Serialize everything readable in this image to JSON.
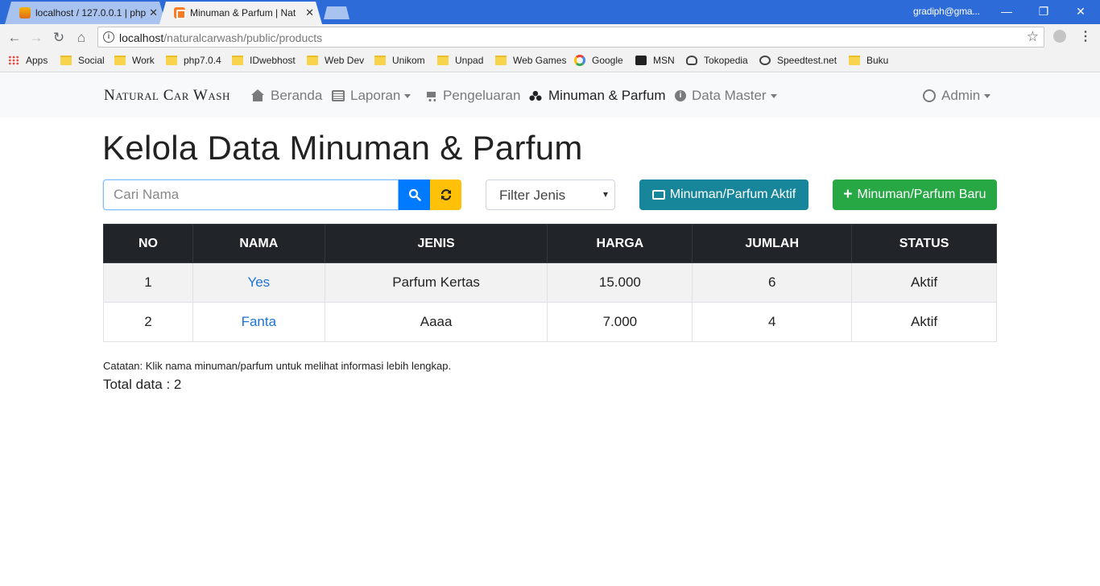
{
  "browser": {
    "tabs": [
      {
        "title": "localhost / 127.0.0.1 | php",
        "icon": "phpmyadmin-icon",
        "active": false
      },
      {
        "title": "Minuman & Parfum | Nat",
        "icon": "xampp-icon",
        "active": true
      }
    ],
    "profile": "gradiph@gma...",
    "url_host": "localhost",
    "url_path": "/naturalcarwash/public/products",
    "bookmarks": [
      {
        "label": "Apps",
        "icon": "apps-grid-icon"
      },
      {
        "label": "Social",
        "icon": "folder-icon"
      },
      {
        "label": "Work",
        "icon": "folder-icon"
      },
      {
        "label": "php7.0.4",
        "icon": "folder-icon"
      },
      {
        "label": "IDwebhost",
        "icon": "folder-icon"
      },
      {
        "label": "Web Dev",
        "icon": "folder-icon"
      },
      {
        "label": "Unikom",
        "icon": "folder-icon"
      },
      {
        "label": "Unpad",
        "icon": "folder-icon"
      },
      {
        "label": "Web Games",
        "icon": "folder-icon"
      },
      {
        "label": "Google",
        "icon": "google-icon"
      },
      {
        "label": "MSN",
        "icon": "msn-icon"
      },
      {
        "label": "Tokopedia",
        "icon": "tokopedia-icon"
      },
      {
        "label": "Speedtest.net",
        "icon": "speedtest-icon"
      },
      {
        "label": "Buku",
        "icon": "folder-icon"
      }
    ]
  },
  "navbar": {
    "brand": "Natural Car Wash",
    "items": [
      {
        "label": "Beranda",
        "icon": "home-icon",
        "active": false,
        "dropdown": false
      },
      {
        "label": "Laporan",
        "icon": "newspaper-icon",
        "active": false,
        "dropdown": true
      },
      {
        "label": "Pengeluaran",
        "icon": "cart-icon",
        "active": false,
        "dropdown": false
      },
      {
        "label": "Minuman & Parfum",
        "icon": "cubes-icon",
        "active": true,
        "dropdown": false
      },
      {
        "label": "Data Master",
        "icon": "info-circle-icon",
        "active": false,
        "dropdown": true
      }
    ],
    "user": {
      "label": "Admin",
      "icon": "user-circle-icon",
      "dropdown": true
    }
  },
  "main": {
    "title": "Kelola Data Minuman & Parfum",
    "search_placeholder": "Cari Nama",
    "search_value": "",
    "filter_label": "Filter Jenis",
    "btn_aktif": "Minuman/Parfum Aktif",
    "btn_baru": "Minuman/Parfum Baru",
    "table": {
      "headers": [
        "NO",
        "NAMA",
        "JENIS",
        "HARGA",
        "JUMLAH",
        "STATUS"
      ],
      "rows": [
        {
          "no": "1",
          "nama": "Yes",
          "jenis": "Parfum Kertas",
          "harga": "15.000",
          "jumlah": "6",
          "status": "Aktif"
        },
        {
          "no": "2",
          "nama": "Fanta",
          "jenis": "Aaaa",
          "harga": "7.000",
          "jumlah": "4",
          "status": "Aktif"
        }
      ]
    },
    "note": "Catatan: Klik nama minuman/parfum untuk melihat informasi lebih lengkap.",
    "total": "Total data : 2"
  },
  "colors": {
    "primary": "#007bff",
    "warning": "#ffc107",
    "info": "#17869b",
    "success": "#28a745",
    "table_header": "#212529",
    "link": "#1e74d6"
  }
}
